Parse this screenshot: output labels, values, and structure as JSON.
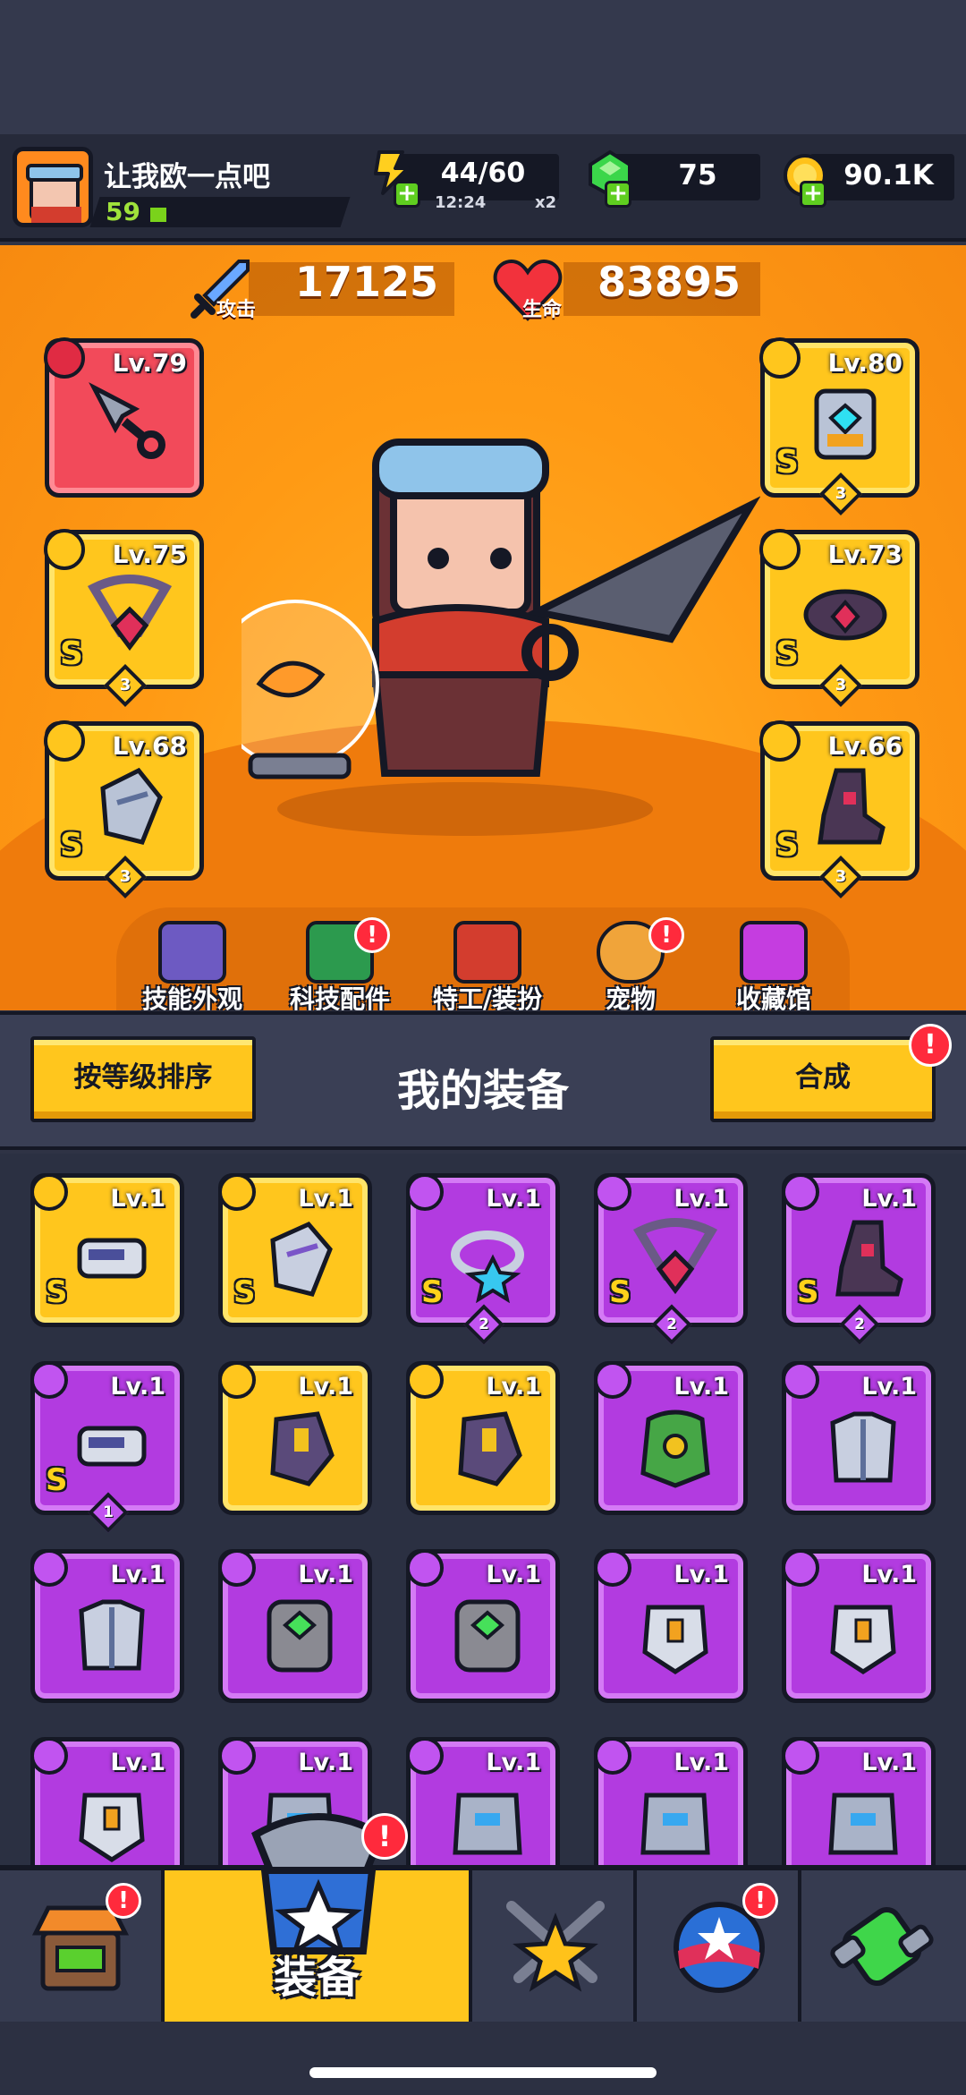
{
  "player": {
    "name": "让我欧一点吧",
    "level": "59"
  },
  "resources": {
    "energy": {
      "value": "44/60",
      "timer": "12:24",
      "multiplier": "x2"
    },
    "gems": {
      "value": "75"
    },
    "coins": {
      "value": "90.1K"
    }
  },
  "stats": {
    "attack": {
      "label": "攻击",
      "value": "17125"
    },
    "health": {
      "label": "生命",
      "value": "83895"
    }
  },
  "equipped": {
    "weapon": {
      "level": "Lv.79"
    },
    "armor": {
      "level": "Lv.80",
      "rank": "S",
      "stars": "3"
    },
    "necklace": {
      "level": "Lv.75",
      "rank": "S",
      "stars": "3"
    },
    "belt": {
      "level": "Lv.73",
      "rank": "S",
      "stars": "3"
    },
    "gloves": {
      "level": "Lv.68",
      "rank": "S",
      "stars": "3"
    },
    "boots": {
      "level": "Lv.66",
      "rank": "S",
      "stars": "3"
    }
  },
  "hero_menu": [
    {
      "label": "技能外观",
      "badge": ""
    },
    {
      "label": "科技配件",
      "badge": "!"
    },
    {
      "label": "特工/装扮",
      "badge": ""
    },
    {
      "label": "宠物",
      "badge": "!"
    },
    {
      "label": "收藏馆",
      "badge": ""
    }
  ],
  "equip_bar": {
    "sort_label": "按等级排序",
    "title": "我的装备",
    "merge_label": "合成",
    "merge_badge": "!"
  },
  "inventory": [
    {
      "level": "Lv.1",
      "rarity": "gold",
      "rank": "S",
      "stars": ""
    },
    {
      "level": "Lv.1",
      "rarity": "gold",
      "rank": "S",
      "stars": ""
    },
    {
      "level": "Lv.1",
      "rarity": "purple",
      "rank": "S",
      "stars": "2"
    },
    {
      "level": "Lv.1",
      "rarity": "purple",
      "rank": "S",
      "stars": "2"
    },
    {
      "level": "Lv.1",
      "rarity": "purple",
      "rank": "S",
      "stars": "2"
    },
    {
      "level": "Lv.1",
      "rarity": "purple",
      "rank": "S",
      "stars": "1"
    },
    {
      "level": "Lv.1",
      "rarity": "gold",
      "rank": "",
      "stars": ""
    },
    {
      "level": "Lv.1",
      "rarity": "gold",
      "rank": "",
      "stars": ""
    },
    {
      "level": "Lv.1",
      "rarity": "purple",
      "rank": "",
      "stars": ""
    },
    {
      "level": "Lv.1",
      "rarity": "purple",
      "rank": "",
      "stars": ""
    },
    {
      "level": "Lv.1",
      "rarity": "purple",
      "rank": "",
      "stars": ""
    },
    {
      "level": "Lv.1",
      "rarity": "purple",
      "rank": "",
      "stars": ""
    },
    {
      "level": "Lv.1",
      "rarity": "purple",
      "rank": "",
      "stars": ""
    },
    {
      "level": "Lv.1",
      "rarity": "purple",
      "rank": "",
      "stars": ""
    },
    {
      "level": "Lv.1",
      "rarity": "purple",
      "rank": "",
      "stars": ""
    },
    {
      "level": "Lv.1",
      "rarity": "purple",
      "rank": "",
      "stars": ""
    },
    {
      "level": "Lv.1",
      "rarity": "purple",
      "rank": "",
      "stars": ""
    },
    {
      "level": "Lv.1",
      "rarity": "purple",
      "rank": "",
      "stars": ""
    },
    {
      "level": "Lv.1",
      "rarity": "purple",
      "rank": "",
      "stars": ""
    },
    {
      "level": "Lv.1",
      "rarity": "purple",
      "rank": "",
      "stars": ""
    }
  ],
  "bottom_nav": [
    {
      "icon": "shop-icon",
      "label": "",
      "badge": "!"
    },
    {
      "icon": "equipment-icon",
      "label": "装备",
      "badge": "!"
    },
    {
      "icon": "crossed-swords-star-icon",
      "label": "",
      "badge": ""
    },
    {
      "icon": "planet-icon",
      "label": "",
      "badge": "!"
    },
    {
      "icon": "dna-capsule-icon",
      "label": "",
      "badge": ""
    }
  ],
  "colors": {
    "gold_card": "#ffc61d",
    "purple_card": "#b23be0",
    "hero_bg": "#ff9a14",
    "badge_red": "#ff2a3c"
  }
}
